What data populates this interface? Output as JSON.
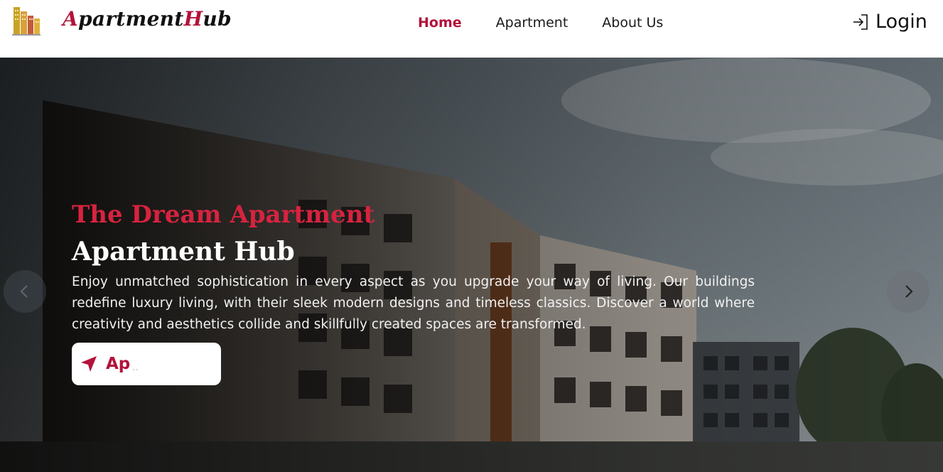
{
  "brand": {
    "part1_accent": "A",
    "part1": "partment",
    "part2_accent": "H",
    "part2": "ub"
  },
  "nav": {
    "items": [
      {
        "label": "Home",
        "active": true
      },
      {
        "label": "Apartment",
        "active": false
      },
      {
        "label": "About Us",
        "active": false
      }
    ],
    "login_label": "Login"
  },
  "hero": {
    "subtitle": "The Dream Apartment",
    "title": "Apartment Hub",
    "description": "Enjoy unmatched sophistication in every aspect as you upgrade your way of living. Our buildings redefine luxury living, with their sleek modern designs and timeless classics. Discover a world where creativity and aesthetics collide and skillfully created spaces are transformed.",
    "cta_label": "Ap",
    "cta_trailing": ".."
  },
  "icons": {
    "logo": "building-logo-icon",
    "login": "login-icon",
    "cta": "location-arrow-icon",
    "prev": "chevron-left-icon",
    "next": "chevron-right-icon"
  },
  "colors": {
    "accent": "#b3123a",
    "hero_accent": "#d7233f",
    "text_dark": "#111111"
  }
}
